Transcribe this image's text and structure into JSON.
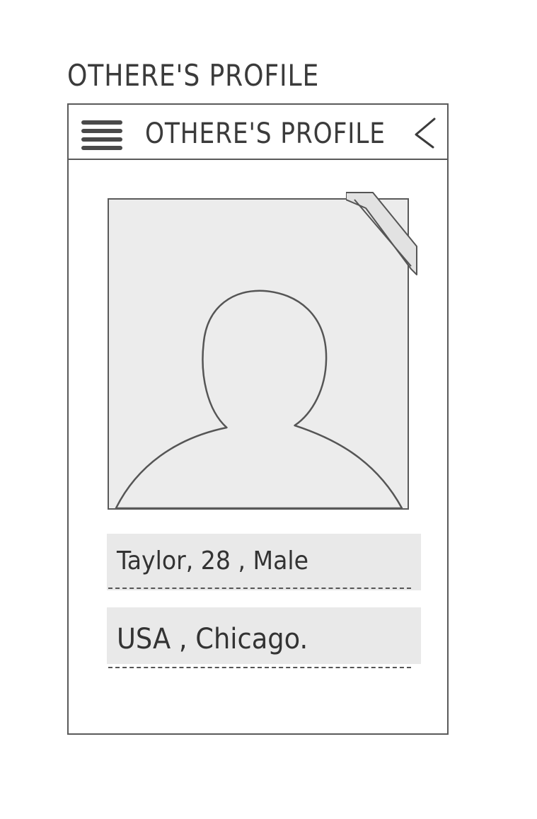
{
  "page": {
    "title": "OTHERE'S PROFILE"
  },
  "app_bar": {
    "title": "OTHERE'S PROFILE",
    "menu_icon": "hamburger-menu-icon",
    "back_icon": "chevron-left-icon"
  },
  "profile": {
    "photo_icon": "person-silhouette-icon",
    "basic_info": "Taylor, 28 , Male",
    "location": "USA , Chicago."
  },
  "colors": {
    "line": "#5a5a5a",
    "field_background": "#e9e9e9",
    "photo_background": "#ececec"
  }
}
